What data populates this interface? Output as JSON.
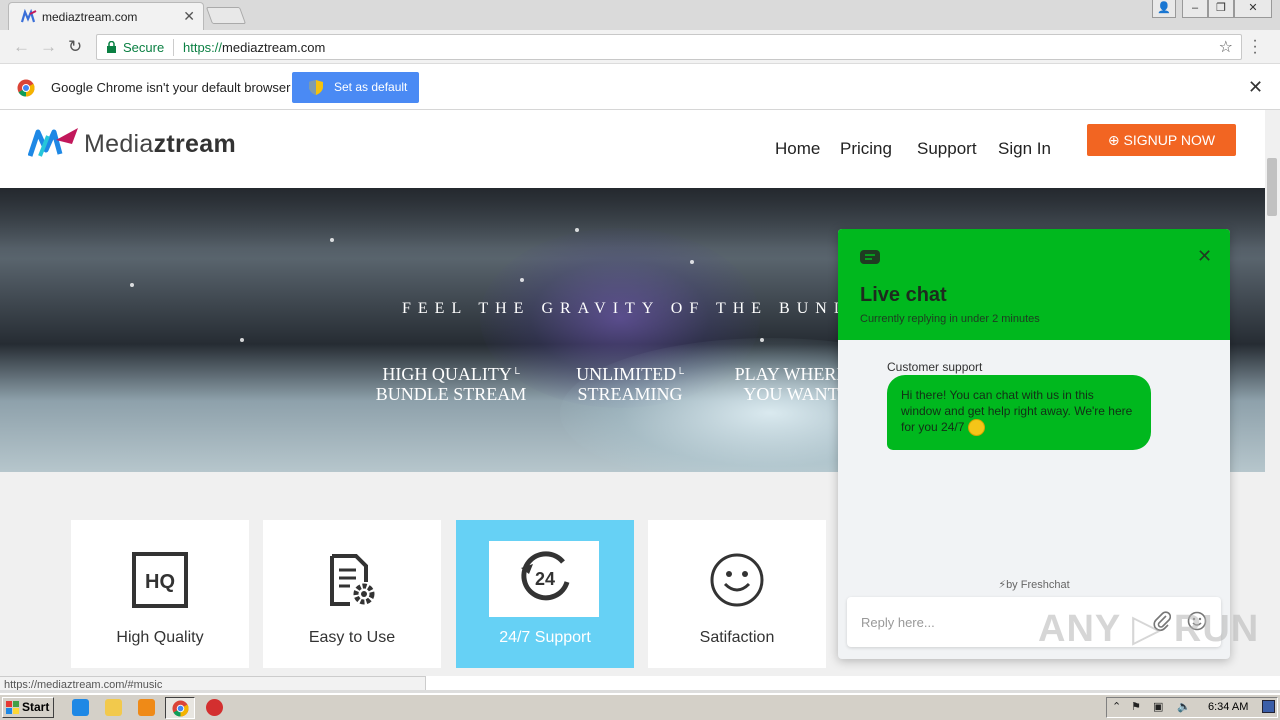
{
  "browser": {
    "tab_title": "mediaztream.com",
    "tab_close": "✕",
    "secure_label": "Secure",
    "url_scheme": "https://",
    "url_host": "mediaztream.com",
    "infobar_text": "Google Chrome isn't your default browser",
    "set_default_label": "Set as default",
    "status_url": "https://mediaztream.com/#music"
  },
  "site": {
    "logo_text_light": "Media",
    "logo_text_bold": "ztream",
    "nav": [
      "Home",
      "Pricing",
      "Support",
      "Sign In"
    ],
    "signup_label": "SIGNUP NOW",
    "tagline": "FEEL THE GRAVITY OF THE BUNDLE",
    "features": [
      {
        "line1": "HIGH QUALITY",
        "line2": "BUNDLE STREAM"
      },
      {
        "line1": "UNLIMITED",
        "line2": "STREAMING"
      },
      {
        "line1": "PLAY WHERE",
        "line2": "YOU WANT"
      }
    ],
    "cards": [
      {
        "label": "High Quality",
        "icon": "hq-icon"
      },
      {
        "label": "Easy to Use",
        "icon": "document-gear-icon"
      },
      {
        "label": "24/7 Support",
        "icon": "clock-24-icon",
        "active": true,
        "icon_text": "24"
      },
      {
        "label": "Satifaction",
        "icon": "smiley-icon"
      }
    ]
  },
  "chat": {
    "title": "Live chat",
    "subtitle": "Currently replying in under 2 minutes",
    "agent_name": "Customer support",
    "message": "Hi there! You can chat with us in this window and get help right away. We're here for you 24/7",
    "powered_by": "⚡by Freshchat",
    "reply_placeholder": "Reply here...",
    "accent": "#00b81e"
  },
  "watermark": "ANY ▷ RUN",
  "taskbar": {
    "start_label": "Start",
    "clock": "6:34 AM"
  }
}
